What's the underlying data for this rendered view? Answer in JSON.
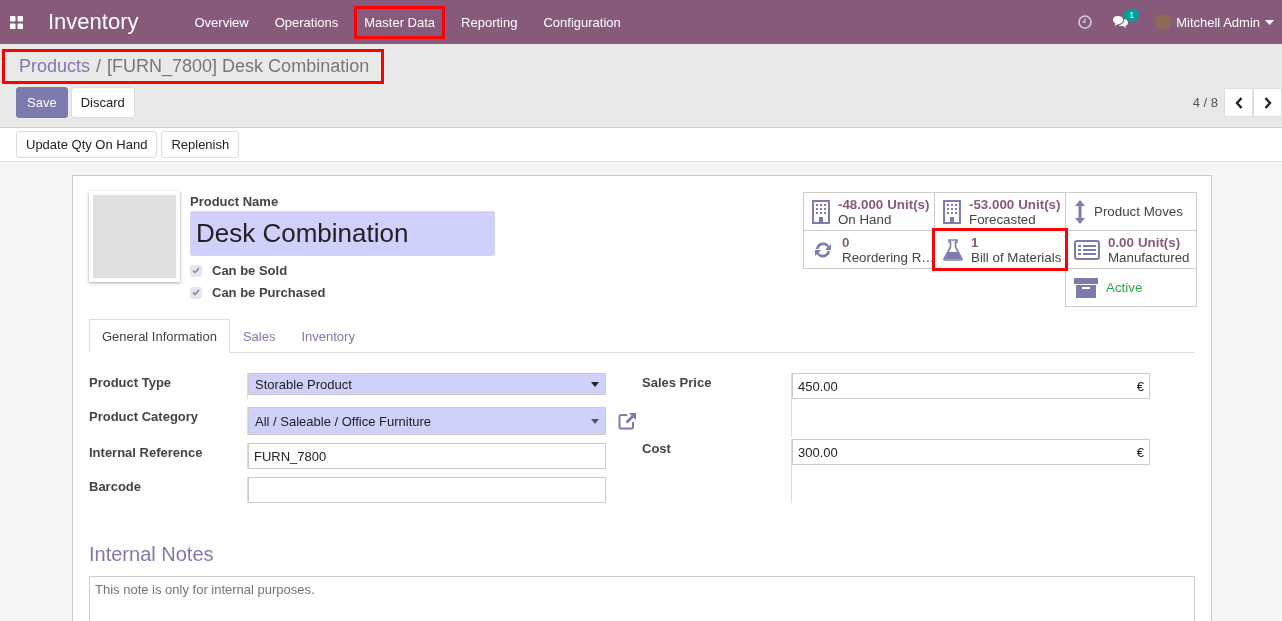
{
  "navbar": {
    "app_title": "Inventory",
    "menu": [
      {
        "label": "Overview",
        "highlighted": false
      },
      {
        "label": "Operations",
        "highlighted": false
      },
      {
        "label": "Master Data",
        "highlighted": true
      },
      {
        "label": "Reporting",
        "highlighted": false
      },
      {
        "label": "Configuration",
        "highlighted": false
      }
    ],
    "messages_badge": "1",
    "user": "Mitchell Admin"
  },
  "breadcrumb": {
    "parent": "Products",
    "separator": "/",
    "current": "[FURN_7800] Desk Combination",
    "highlighted": true
  },
  "buttons": [
    {
      "label": "Save",
      "kind": "primary"
    },
    {
      "label": "Discard",
      "kind": "secondary"
    }
  ],
  "pager": "4 / 8",
  "header_buttons": [
    "Update Qty On Hand",
    "Replenish"
  ],
  "product": {
    "name_label": "Product Name",
    "name": "Desk Combination",
    "checkboxes": [
      {
        "label": "Can be Sold",
        "checked": true
      },
      {
        "label": "Can be Purchased",
        "checked": true
      }
    ]
  },
  "stat_buttons": [
    {
      "kind": "stock",
      "value": "-48.000",
      "unit": "Unit(s)",
      "label": "On Hand",
      "highlighted": false
    },
    {
      "kind": "stock",
      "value": "-53.000",
      "unit": "Unit(s)",
      "label": "Forecasted",
      "highlighted": false
    },
    {
      "kind": "moves",
      "label": "Product Moves",
      "highlighted": false
    },
    {
      "kind": "reorder",
      "value": "0",
      "label": "Reordering R…",
      "highlighted": false
    },
    {
      "kind": "bom",
      "value": "1",
      "label": "Bill of Materials",
      "highlighted": true
    },
    {
      "kind": "manufactured",
      "value": "0.00",
      "unit": "Unit(s)",
      "label": "Manufactured",
      "highlighted": false
    },
    {
      "kind": "active",
      "label": "Active",
      "highlighted": false
    }
  ],
  "tabs": [
    {
      "label": "General Information",
      "selected": true
    },
    {
      "label": "Sales",
      "selected": false
    },
    {
      "label": "Inventory",
      "selected": false
    }
  ],
  "left_fields": [
    {
      "label": "Product Type",
      "value": "Storable Product",
      "kind": "select"
    },
    {
      "label": "Product Category",
      "value": "All / Saleable / Office Furniture",
      "kind": "many2one"
    },
    {
      "label": "Internal Reference",
      "value": "FURN_7800",
      "kind": "text"
    },
    {
      "label": "Barcode",
      "kind": "text"
    }
  ],
  "right_fields": [
    {
      "label": "Sales Price",
      "value": "450.00",
      "currency": "€"
    },
    {
      "label": "Cost",
      "value": "300.00",
      "currency": "€"
    }
  ],
  "notes": {
    "title": "Internal Notes",
    "placeholder": "This note is only for internal purposes."
  }
}
